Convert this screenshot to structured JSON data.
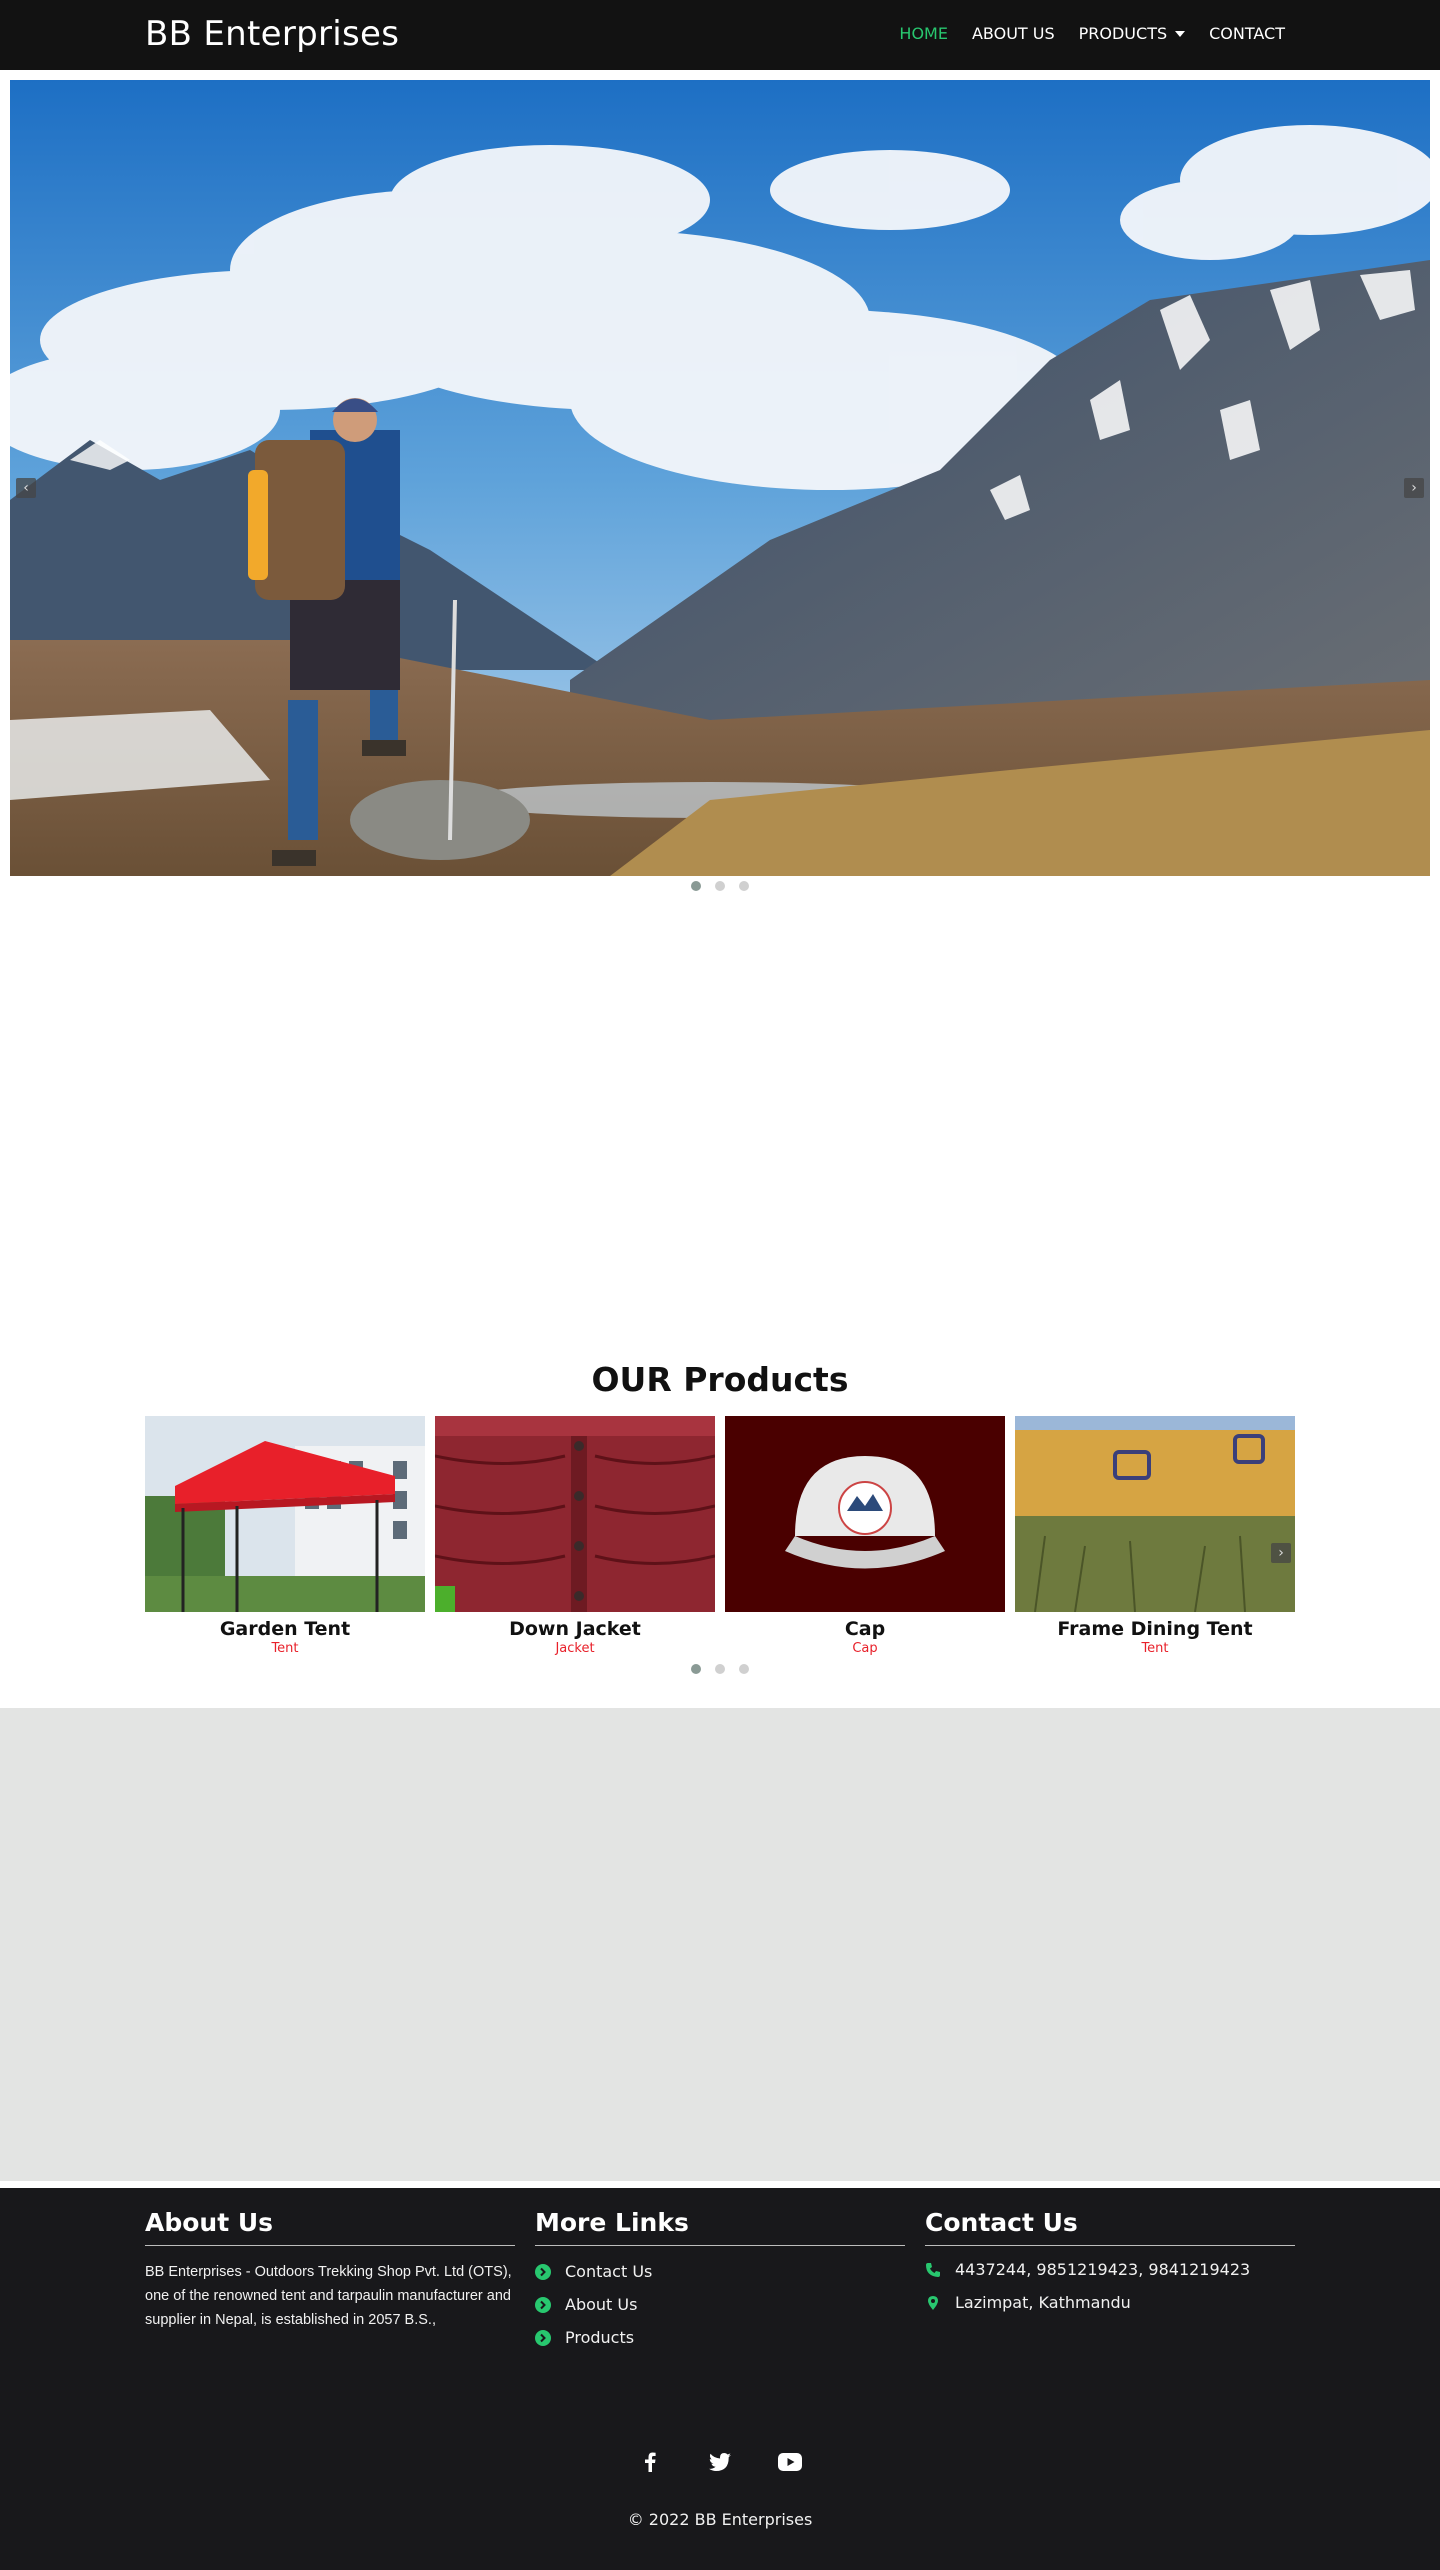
{
  "header": {
    "brand": "BB Enterprises",
    "nav": [
      {
        "label": "HOME",
        "active": true
      },
      {
        "label": "ABOUT US",
        "active": false
      },
      {
        "label": "PRODUCTS",
        "active": false,
        "dropdown": true
      },
      {
        "label": "CONTACT",
        "active": false
      }
    ]
  },
  "hero": {
    "prev_icon": "‹",
    "next_icon": "›",
    "slide_count": 3,
    "active_slide": 1
  },
  "products": {
    "title": "OUR Products",
    "items": [
      {
        "name": "Garden Tent",
        "category": "Tent"
      },
      {
        "name": "Down Jacket",
        "category": "Jacket"
      },
      {
        "name": "Cap",
        "category": "Cap"
      },
      {
        "name": "Frame Dining Tent",
        "category": "Tent"
      }
    ],
    "next_icon": "›",
    "page_count": 3,
    "active_page": 1
  },
  "footer": {
    "about": {
      "title": "About Us",
      "text": "BB Enterprises - Outdoors Trekking Shop Pvt. Ltd (OTS), one of the renowned tent and tarpaulin manufacturer and supplier in Nepal, is established in 2057 B.S.,"
    },
    "links": {
      "title": "More Links",
      "items": [
        "Contact Us",
        "About Us",
        "Products"
      ]
    },
    "contact": {
      "title": "Contact Us",
      "phone": "4437244, 9851219423, 9841219423",
      "address": "Lazimpat, Kathmandu"
    },
    "social_icons": [
      "facebook-icon",
      "twitter-icon",
      "youtube-icon"
    ],
    "copyright": "© 2022 BB Enterprises"
  },
  "colors": {
    "accent": "#28c76f",
    "header_bg": "#121212",
    "footer_bg": "#18181b",
    "gray_section": "#e3e4e3",
    "category_red": "#e8202a"
  }
}
